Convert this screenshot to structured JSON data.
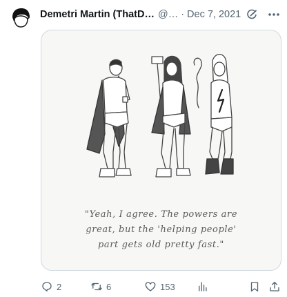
{
  "tweet": {
    "display_name": "Demetri Martin (ThatD…",
    "handle": "@…",
    "separator": "·",
    "date": "Dec 7, 2021",
    "caption_lines": [
      "\"Yeah, I agree. The powers are",
      "great, but the 'helping people'",
      "part gets old pretty fast.\""
    ]
  },
  "actions": {
    "replies": "2",
    "retweets": "6",
    "likes": "153"
  },
  "icons": {
    "avatar": "avatar-image",
    "edit": "edited-icon",
    "more": "more-icon",
    "reply": "reply-icon",
    "retweet": "retweet-icon",
    "like": "heart-icon",
    "views": "views-chart-icon",
    "bookmark": "bookmark-icon",
    "share": "share-icon"
  },
  "colors": {
    "text_primary": "#0f1419",
    "text_secondary": "#536471",
    "card_border": "#cfd9de"
  }
}
